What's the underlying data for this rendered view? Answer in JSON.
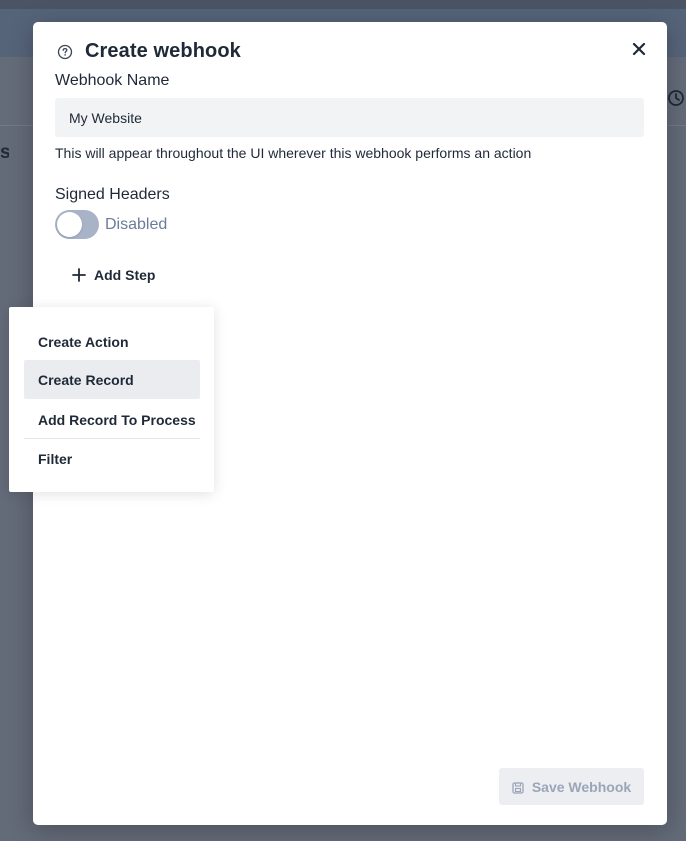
{
  "background": {
    "edge_text": "s"
  },
  "modal": {
    "title": "Create webhook",
    "webhook_name": {
      "label": "Webhook Name",
      "value": "My Website",
      "help": "This will appear throughout the UI wherever this webhook performs an action"
    },
    "signed_headers": {
      "label": "Signed Headers",
      "state": "Disabled"
    },
    "add_step_label": "Add Step",
    "save_label": "Save Webhook"
  },
  "dropdown": {
    "items": [
      {
        "label": "Create Action"
      },
      {
        "label": "Create Record",
        "active": true
      },
      {
        "label": "Add Record To Process"
      },
      {
        "label": "Filter"
      }
    ]
  },
  "colors": {
    "toggle_off": "#a8b3c8",
    "toggle_text": "#6b7c9a",
    "disabled_button_bg": "#eceef2",
    "disabled_button_text": "#9aa6b8",
    "overlay": "#5b6477"
  }
}
